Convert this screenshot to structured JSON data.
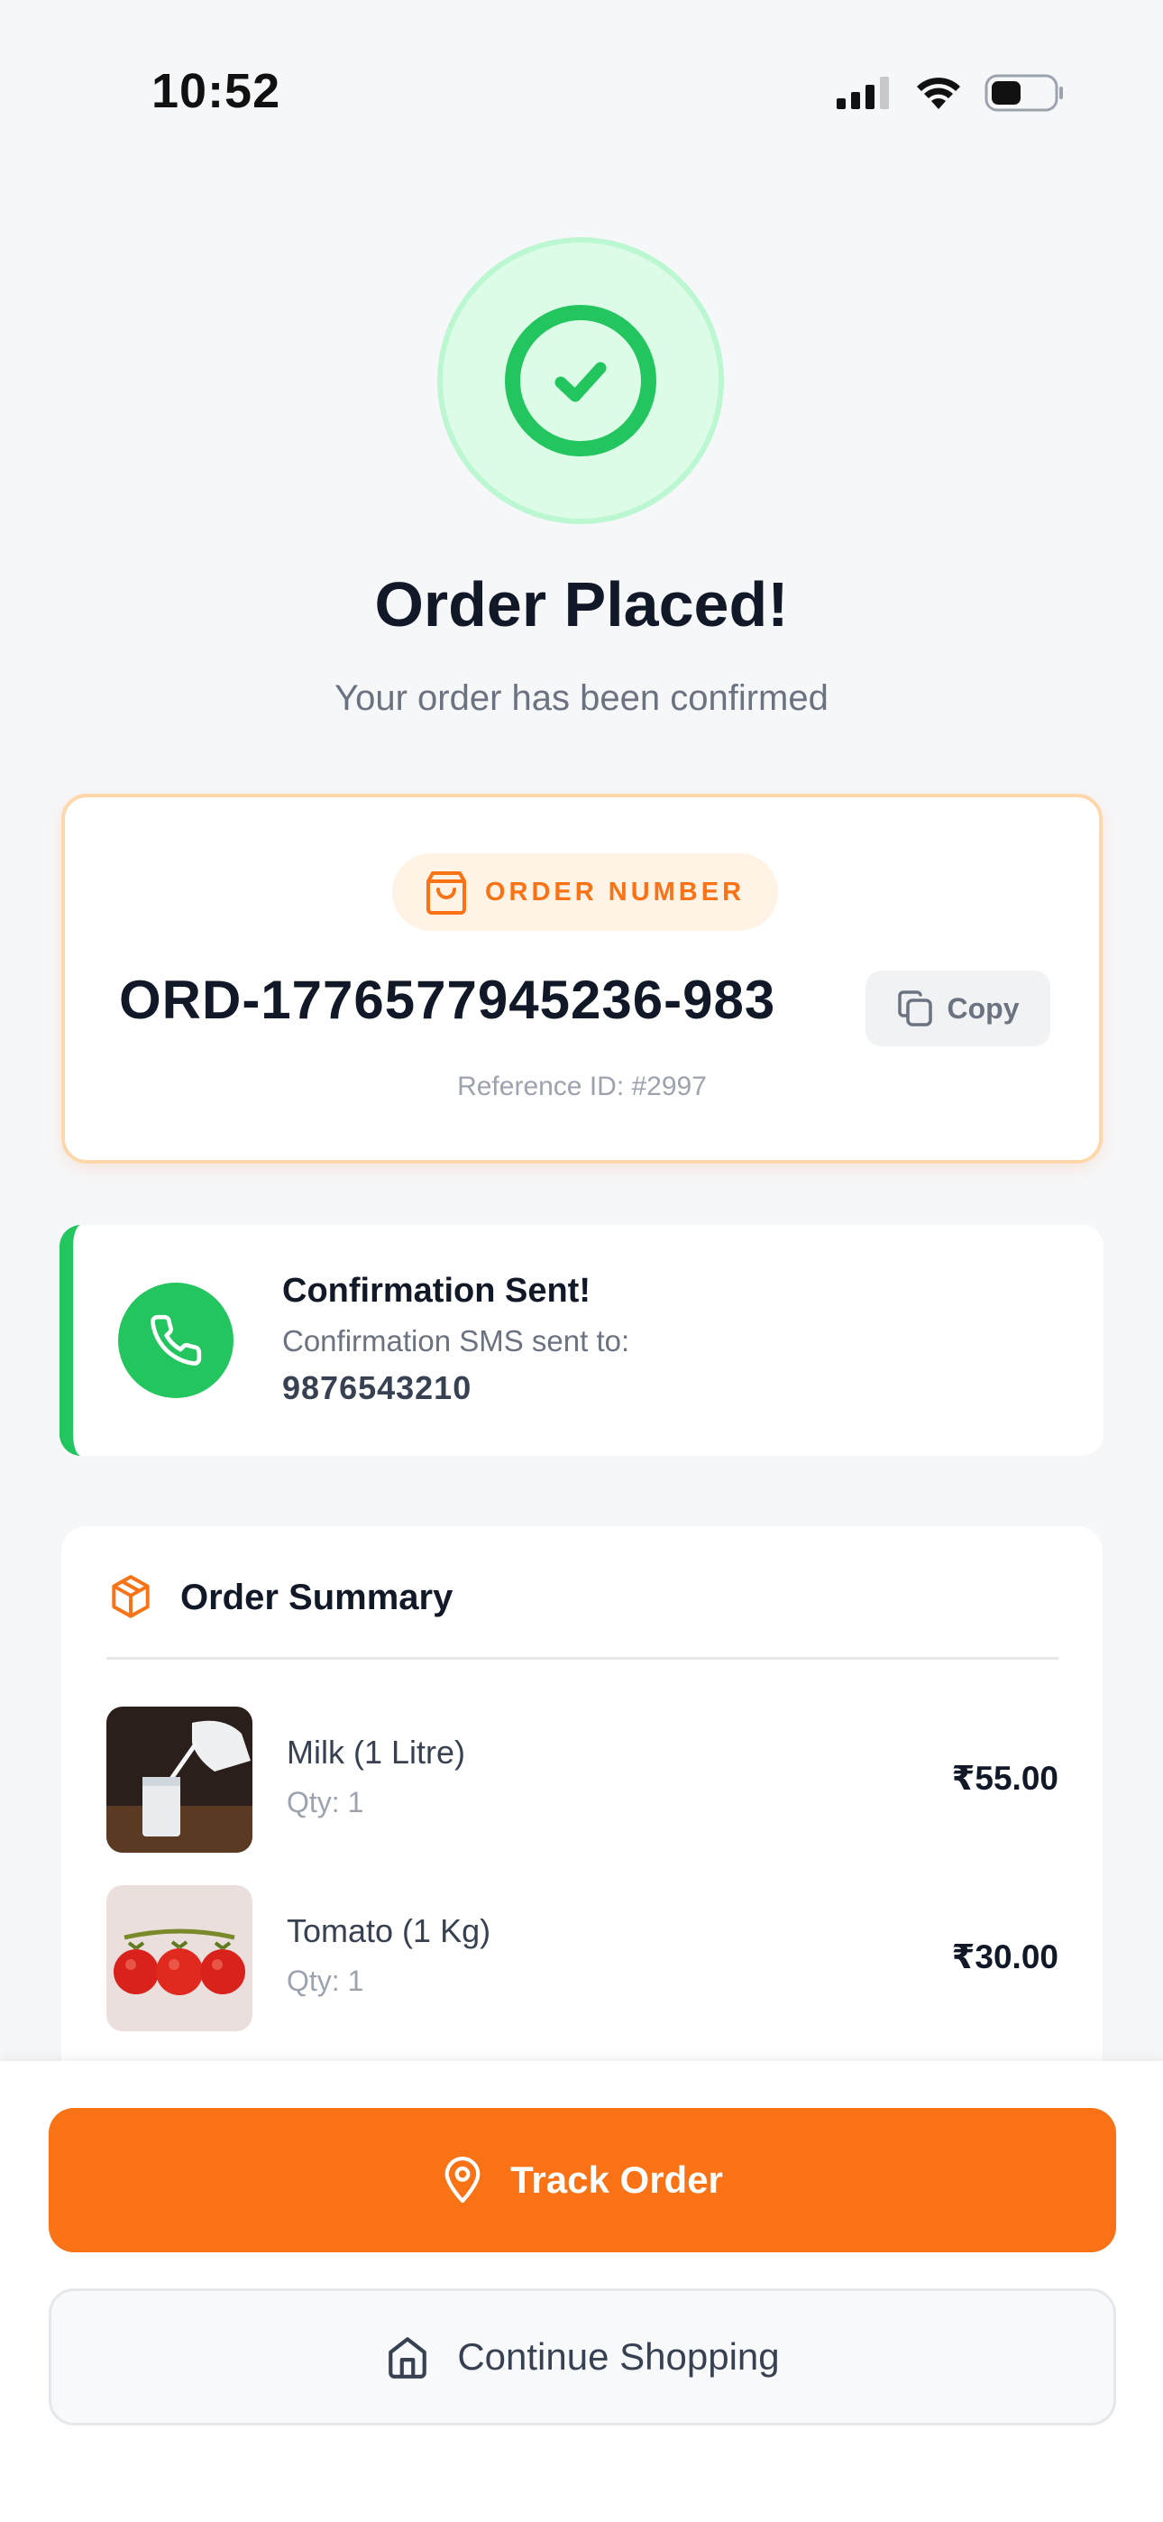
{
  "status_bar": {
    "time": "10:52",
    "icons": [
      "cellular-signal-icon",
      "wifi-icon",
      "battery-icon"
    ]
  },
  "success": {
    "icon": "check-circle-icon",
    "title": "Order Placed!",
    "subtitle": "Your order has been confirmed"
  },
  "order": {
    "label": "ORDER NUMBER",
    "label_icon": "shopping-bag-icon",
    "number": "ORD-1776577945236-983",
    "copy_label": "Copy",
    "copy_icon": "copy-icon",
    "reference": "Reference ID: #2997"
  },
  "confirmation": {
    "icon": "phone-icon",
    "title": "Confirmation Sent!",
    "description": "Confirmation SMS sent to:",
    "phone": "9876543210"
  },
  "summary": {
    "icon": "package-icon",
    "title": "Order Summary",
    "items": [
      {
        "name": "Milk (1 Litre)",
        "qty": "Qty: 1",
        "price": "₹55.00",
        "image": "milk-image"
      },
      {
        "name": "Tomato (1 Kg)",
        "qty": "Qty: 1",
        "price": "₹30.00",
        "image": "tomato-image"
      }
    ]
  },
  "actions": {
    "track_label": "Track Order",
    "track_icon": "map-pin-icon",
    "continue_label": "Continue Shopping",
    "continue_icon": "home-icon"
  },
  "colors": {
    "accent": "#f97316",
    "success": "#22c55e",
    "success_bg": "#dcfce7",
    "background": "#f6f7f9"
  }
}
